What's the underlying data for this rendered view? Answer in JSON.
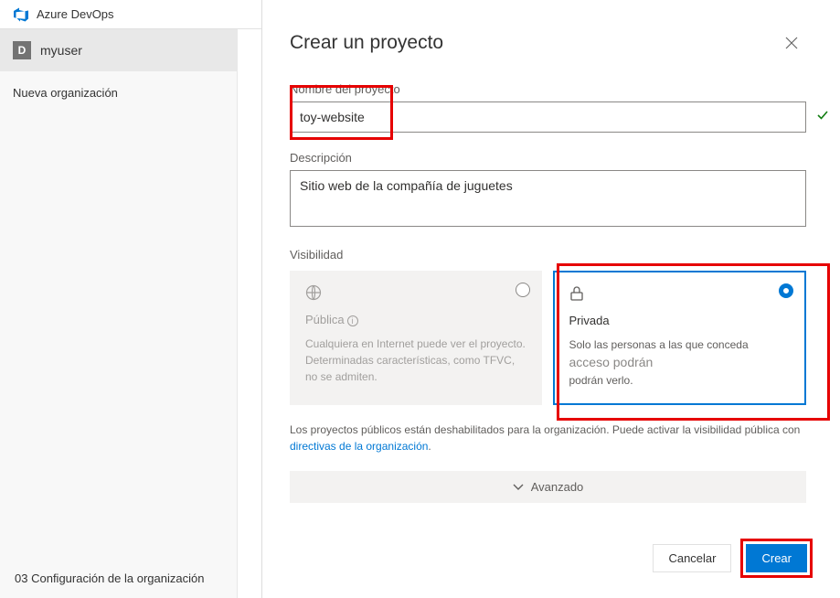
{
  "brand": "Azure DevOps",
  "user": {
    "initial": "D",
    "name": "myuser"
  },
  "sidebar": {
    "new_org": "Nueva organización",
    "bottom_link": "Configuración de la organización"
  },
  "bottom_link_prefix": "03",
  "dialog": {
    "title": "Crear un proyecto",
    "name_label": "Nombre del proyecto",
    "name_value": "toy-website",
    "desc_label": "Descripción",
    "desc_value": "Sitio web de la compañía de juguetes",
    "vis_label": "Visibilidad",
    "public": {
      "title": "Pública",
      "desc": "Cualquiera en Internet puede ver el proyecto. Determinadas características, como TFVC, no se admiten."
    },
    "private": {
      "title": "Privada",
      "desc1": "Solo las personas a las que conceda",
      "desc_big": "acceso podrán",
      "desc2": "podrán verlo."
    },
    "note_text": "Los proyectos públicos están deshabilitados para la organización. Puede activar la visibilidad pública con ",
    "note_link": "directivas de la organización",
    "advanced": "Avanzado",
    "cancel": "Cancelar",
    "create": "Crear"
  }
}
